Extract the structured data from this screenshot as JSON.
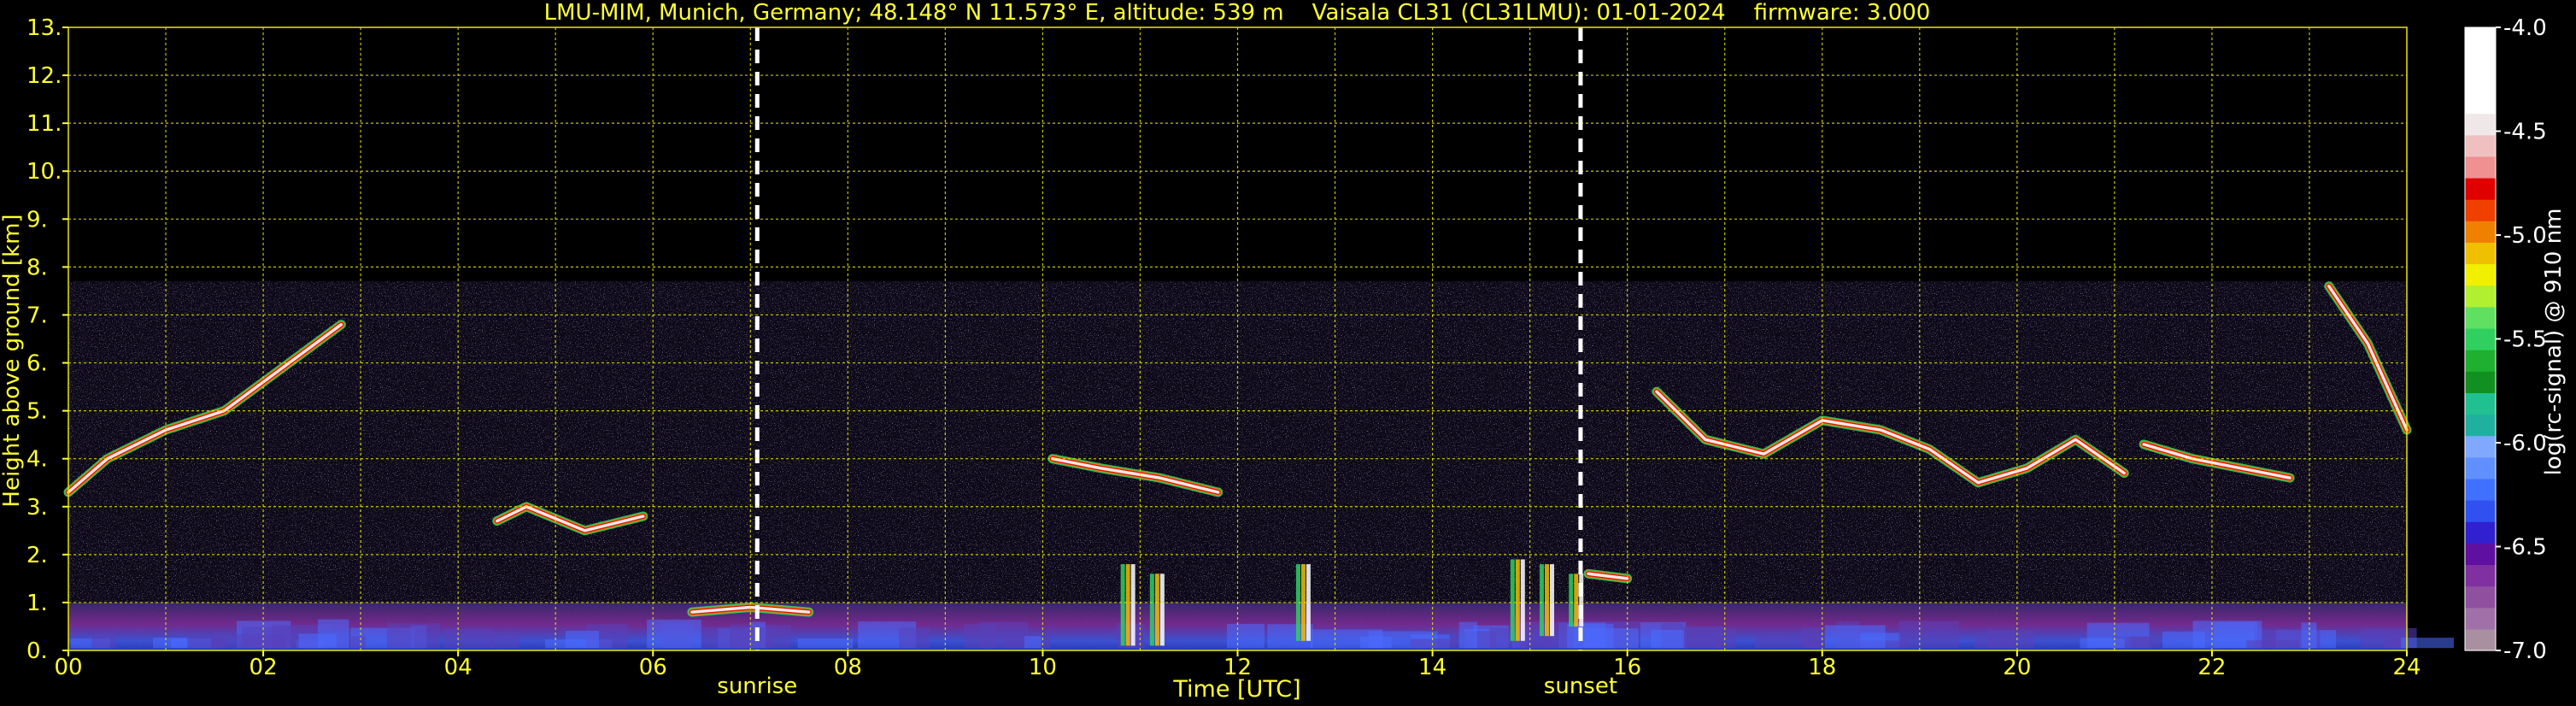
{
  "chart_data": {
    "type": "heatmap",
    "title": "LMU-MIM, Munich, Germany; 48.148° N 11.573° E, altitude: 539 m    Vaisala CL31 (CL31LMU): 01-01-2024    firmware: 3.000",
    "xlabel": "Time [UTC]",
    "ylabel": "Height above ground [km]",
    "xlim": [
      0,
      24
    ],
    "ylim": [
      0,
      13
    ],
    "x_ticks": [
      "00",
      "02",
      "04",
      "06",
      "08",
      "10",
      "12",
      "14",
      "16",
      "18",
      "20",
      "22",
      "24"
    ],
    "y_ticks": [
      "0.",
      "1.",
      "2.",
      "3.",
      "4.",
      "5.",
      "6.",
      "7.",
      "8.",
      "9.",
      "10.",
      "11.",
      "12.",
      "13."
    ],
    "grid": true,
    "grid_color": "#e8e800",
    "data_max_height_km": 7.7,
    "markers": [
      {
        "label": "sunrise",
        "x": 7.07
      },
      {
        "label": "sunset",
        "x": 15.52
      }
    ],
    "colorbar": {
      "label": "log(rc-signal) @ 910 nm",
      "range": [
        -7.0,
        -4.0
      ],
      "ticks": [
        "-4.0",
        "-4.5",
        "-5.0",
        "-5.5",
        "-6.0",
        "-6.5",
        "-7.0"
      ],
      "colors": [
        "#a890a0",
        "#a070a8",
        "#9050a0",
        "#8030a0",
        "#6010a0",
        "#3020d0",
        "#3050f0",
        "#4070ff",
        "#6090ff",
        "#80a8ff",
        "#20b0a0",
        "#20c090",
        "#109020",
        "#20b030",
        "#30d060",
        "#60e060",
        "#b0f030",
        "#f0f000",
        "#f0c000",
        "#f08000",
        "#f04000",
        "#e00000",
        "#f09090",
        "#f0c0c0",
        "#f0e8e8",
        "#ffffff",
        "#ffffff",
        "#ffffff",
        "#ffffff"
      ]
    },
    "features": [
      {
        "name": "layer-0",
        "points": [
          [
            0.0,
            3.3
          ],
          [
            0.4,
            4.0
          ],
          [
            1.0,
            4.6
          ],
          [
            1.6,
            5.0
          ],
          [
            2.2,
            5.9
          ],
          [
            2.8,
            6.8
          ]
        ]
      },
      {
        "name": "layer-1",
        "points": [
          [
            4.4,
            2.7
          ],
          [
            4.7,
            3.0
          ],
          [
            5.3,
            2.5
          ],
          [
            5.9,
            2.8
          ]
        ]
      },
      {
        "name": "layer-2",
        "points": [
          [
            6.4,
            0.8
          ],
          [
            7.0,
            0.9
          ],
          [
            7.6,
            0.8
          ]
        ]
      },
      {
        "name": "layer-3",
        "points": [
          [
            10.1,
            4.0
          ],
          [
            10.6,
            3.8
          ],
          [
            11.2,
            3.6
          ],
          [
            11.8,
            3.3
          ]
        ]
      },
      {
        "name": "layer-4",
        "points": [
          [
            15.6,
            1.6
          ],
          [
            16.0,
            1.5
          ]
        ]
      },
      {
        "name": "layer-5",
        "points": [
          [
            16.3,
            5.4
          ],
          [
            16.8,
            4.4
          ],
          [
            17.4,
            4.1
          ],
          [
            18.0,
            4.8
          ],
          [
            18.6,
            4.6
          ],
          [
            19.1,
            4.2
          ],
          [
            19.6,
            3.5
          ],
          [
            20.1,
            3.8
          ],
          [
            20.6,
            4.4
          ],
          [
            21.1,
            3.7
          ]
        ]
      },
      {
        "name": "layer-6",
        "points": [
          [
            21.3,
            4.3
          ],
          [
            21.8,
            4.0
          ],
          [
            22.3,
            3.8
          ],
          [
            22.8,
            3.6
          ]
        ]
      },
      {
        "name": "layer-7",
        "points": [
          [
            23.2,
            7.6
          ],
          [
            23.6,
            6.4
          ],
          [
            24.0,
            4.6
          ]
        ]
      }
    ],
    "vertical_streaks": [
      [
        10.8,
        0.1,
        1.8
      ],
      [
        11.1,
        0.1,
        1.6
      ],
      [
        12.6,
        0.2,
        1.8
      ],
      [
        14.8,
        0.2,
        1.9
      ],
      [
        15.1,
        0.3,
        1.8
      ],
      [
        15.4,
        0.5,
        1.6
      ]
    ]
  }
}
